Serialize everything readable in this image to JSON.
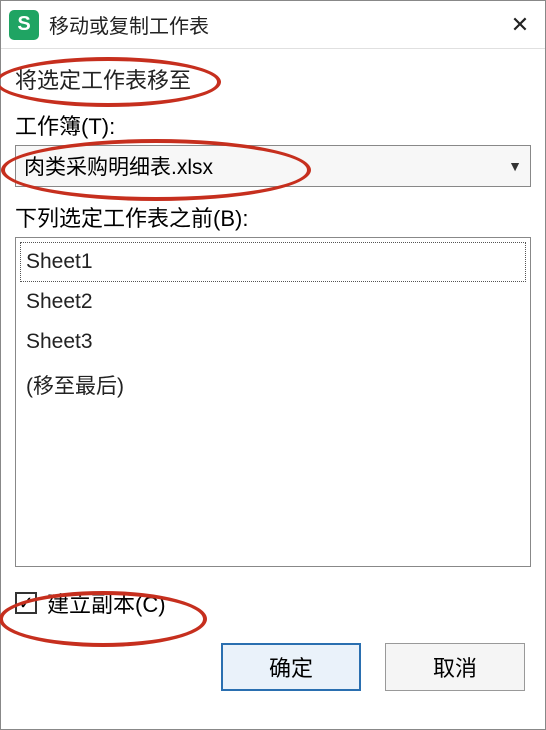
{
  "title": "移动或复制工作表",
  "move_to_label": "将选定工作表移至",
  "workbook_label": "工作簿(T):",
  "workbook_selected": "肉类采购明细表.xlsx",
  "before_sheet_label": "下列选定工作表之前(B):",
  "sheets": {
    "item0": "Sheet1",
    "item1": "Sheet2",
    "item2": "Sheet3",
    "item3": "(移至最后)"
  },
  "selected_sheet_index": 0,
  "create_copy_label": "建立副本(C)",
  "create_copy_checked": true,
  "ok_label": "确定",
  "cancel_label": "取消",
  "app_icon_letter": "S"
}
